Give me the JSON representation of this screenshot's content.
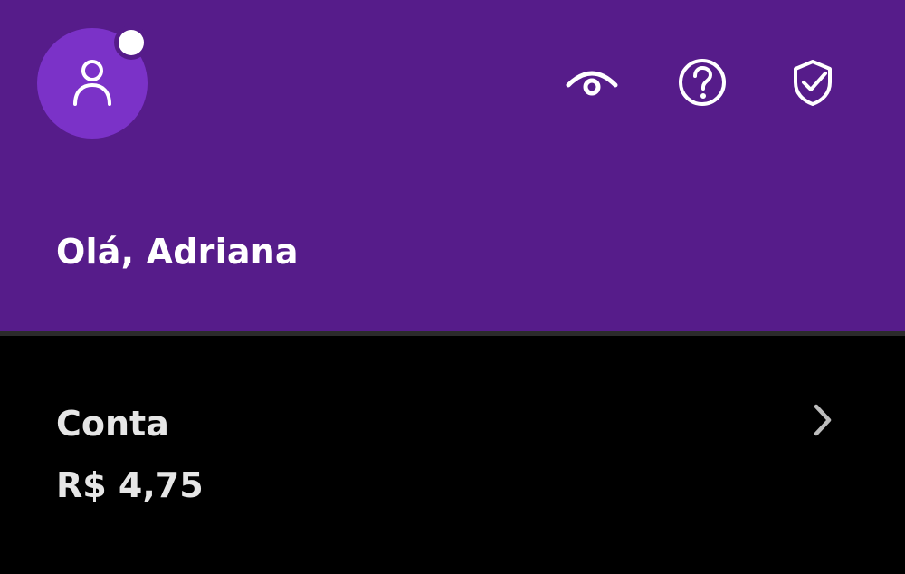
{
  "header": {
    "greeting": "Olá, Adriana",
    "background_color": "#561c8a",
    "avatar_color": "#7b32c8",
    "icons": [
      {
        "name": "eye-icon"
      },
      {
        "name": "help-icon"
      },
      {
        "name": "shield-check-icon"
      }
    ]
  },
  "account": {
    "title": "Conta",
    "balance": "R$ 4,75"
  }
}
